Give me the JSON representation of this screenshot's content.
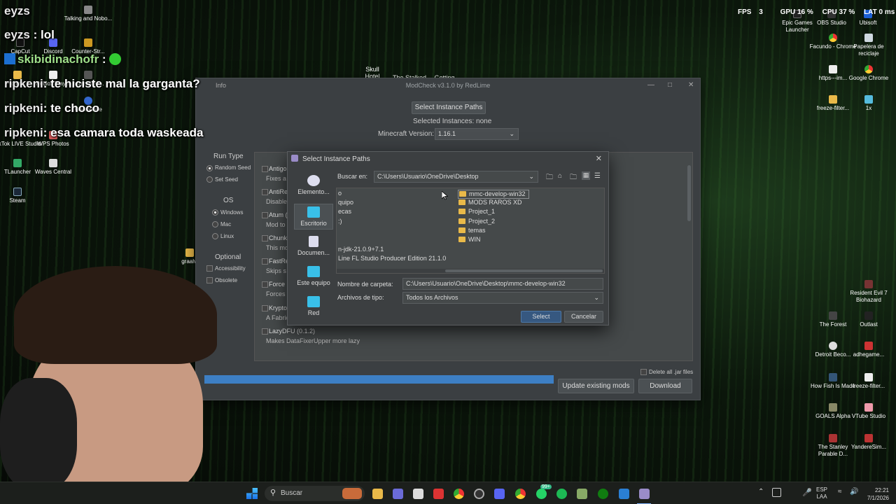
{
  "chat": [
    {
      "user": "eyzs",
      "text": ": lol"
    },
    {
      "user": "skibidinachofr",
      "text": ":"
    },
    {
      "user": "ripkeni",
      "text": ": te hiciste mal la garganta?"
    },
    {
      "user": "ripkeni",
      "text": ": te choco"
    },
    {
      "user": "ripkeni",
      "text": ": esa camara toda waskeada"
    }
  ],
  "chat_top_user": "eyzs",
  "desktop_left": [
    {
      "label": "CapCut"
    },
    {
      "label": "Discord"
    },
    {
      "label": "Counter-Str..."
    },
    {
      "label": "Project_2"
    },
    {
      "label": "Roblox Player"
    },
    {
      "label": "paranoia-4..."
    },
    {
      "label": "Talking and Nobo..."
    },
    {
      "label": "VoiceWave"
    },
    {
      "label": "TikTok LIVE Studio"
    },
    {
      "label": "WPS Photos"
    },
    {
      "label": "TLauncher"
    },
    {
      "label": "Waves Central"
    },
    {
      "label": "Steam"
    },
    {
      "label": "graalvi"
    }
  ],
  "desktop_top": [
    {
      "label": "Skull Hotel"
    },
    {
      "label": "The Stalked 2"
    },
    {
      "label": "Getting Over"
    }
  ],
  "desktop_right": [
    {
      "label": "Epic Games Launcher"
    },
    {
      "label": "OBS Studio"
    },
    {
      "label": "Ubisoft"
    },
    {
      "label": "Facundo - Chrome"
    },
    {
      "label": "Papelera de reciclaje"
    },
    {
      "label": "https---im..."
    },
    {
      "label": "Google Chrome"
    },
    {
      "label": "freeze-filter..."
    },
    {
      "label": "1x"
    },
    {
      "label": "Resident Evil 7 Biohazard"
    },
    {
      "label": "The Forest"
    },
    {
      "label": "Outlast"
    },
    {
      "label": "Detroit Beco..."
    },
    {
      "label": "adhegame..."
    },
    {
      "label": "How Fish Is Made"
    },
    {
      "label": "freeze-filter..."
    },
    {
      "label": "GOALS Alpha"
    },
    {
      "label": "VTube Studio"
    },
    {
      "label": "The Stanley Parable D..."
    },
    {
      "label": "YandereSim..."
    }
  ],
  "overlay_stats": {
    "fps_label": "FPS",
    "fps_value": "3",
    "gpu": "GPU 16 %",
    "cpu": "CPU 37 %",
    "lat": "LAT 0 ms"
  },
  "modcheck": {
    "title": "ModCheck v3.1.0 by RedLime",
    "info_tab": "Info",
    "select_paths_btn": "Select Instance Paths",
    "selected_instances": "Selected Instances: none",
    "mc_version_label": "Minecraft Version:",
    "mc_version_value": "1.16.1",
    "run_type_label": "Run Type",
    "random_seed": "Random Seed",
    "set_seed": "Set Seed",
    "os_label": "OS",
    "windows": "Windows",
    "mac": "Mac",
    "linux": "Linux",
    "optional_label": "Optional",
    "accessibility": "Accessibility",
    "obsolete": "Obsolete",
    "mods": [
      {
        "name": "Antigo",
        "desc": "Fixes a"
      },
      {
        "name": "AntiRe",
        "desc": "Disable"
      },
      {
        "name": "Atum (",
        "desc": "Mod to"
      },
      {
        "name": "Chunk",
        "desc": "This mo"
      },
      {
        "name": "FastRe",
        "desc": "Skips s"
      },
      {
        "name": "Force",
        "desc": "Forces"
      },
      {
        "name": "Krypto",
        "desc": "A Fabric"
      },
      {
        "name": "LazyDFU (0.1.2)",
        "desc": "Makes DataFixerUpper more lazy"
      }
    ],
    "delete_jars": "Delete all .jar files",
    "update_btn": "Update existing mods",
    "download_btn": "Download",
    "progress": 1.0
  },
  "dialog": {
    "title": "Select Instance Paths",
    "look_in_label": "Buscar en:",
    "look_in_value": "C:\\Users\\Usuario\\OneDrive\\Desktop",
    "places": [
      {
        "label": "Elemento..."
      },
      {
        "label": "Escritorio"
      },
      {
        "label": "Documen..."
      },
      {
        "label": "Este equipo"
      },
      {
        "label": "Red"
      }
    ],
    "left_items": [
      "o",
      "quipo",
      "ecas",
      ":)",
      "",
      "n-jdk-21.0.9+7.1",
      "Line FL Studio Producer Edition 21.1.0"
    ],
    "folders": [
      "mmc-develop-win32",
      "MODS RAROS XD",
      "Project_1",
      "Project_2",
      "temas",
      "WIN"
    ],
    "folder_name_label": "Nombre de carpeta:",
    "folder_name_value": "C:\\Users\\Usuario\\OneDrive\\Desktop\\mmc-develop-win32",
    "file_type_label": "Archivos de tipo:",
    "file_type_value": "Todos los Archivos",
    "select_btn": "Select",
    "cancel_btn": "Cancelar"
  },
  "taskbar": {
    "search_placeholder": "Buscar",
    "lang": "ESP",
    "lang2": "LAA",
    "time": "22:21",
    "date": "7/1/2026",
    "badge": "99+"
  }
}
